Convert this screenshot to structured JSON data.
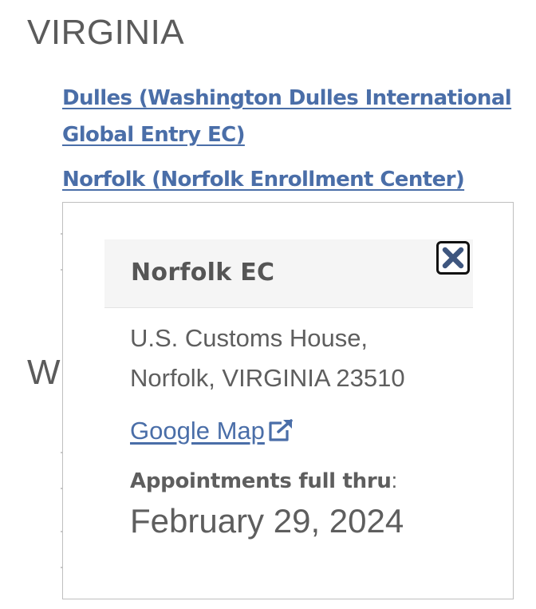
{
  "section": {
    "state_heading": "VIRGINIA",
    "next_state_heading_partial": "WI"
  },
  "locations": [
    {
      "label": "Dulles (Washington Dulles International Global Entry EC)"
    },
    {
      "label": "Norfolk (Norfolk Enrollment Center)"
    }
  ],
  "popup": {
    "title": "Norfolk EC",
    "close_icon": "close-x-icon",
    "address_line1": "U.S. Customs House,",
    "address_line2": "Norfolk, VIRGINIA 23510",
    "map_link_label": "Google Map",
    "map_link_icon": "external-link-icon",
    "appointments_label": "Appointments full thru",
    "appointments_colon": ":",
    "appointments_date": "February 29, 2024"
  },
  "colors": {
    "link": "#4a6ea8",
    "text": "#5e5e5e",
    "close_icon": "#3e567f"
  }
}
